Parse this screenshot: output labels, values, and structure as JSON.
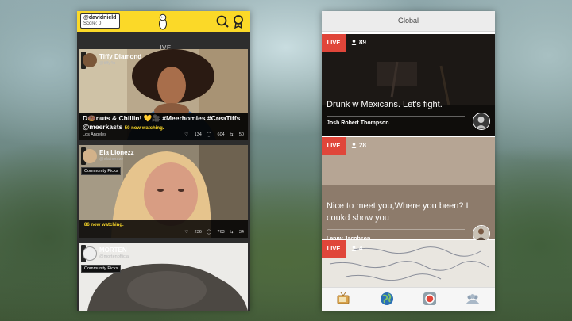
{
  "left_app": {
    "user": {
      "username": "@davidnield",
      "score": "Score: 0"
    },
    "section_label": "LIVE",
    "streams": [
      {
        "name": "Tiffy Diamond",
        "handle": "@tiffy4u",
        "title": "D🍩nuts & Chillin! 💛🎥 #Meerhomies #CreaTiffs @meerkasts",
        "watching": "59 now watching.",
        "location": "Los Angeles",
        "likes": "134",
        "comments": "604",
        "restreams": "50"
      },
      {
        "name": "Ela Lionezz",
        "handle": "@elalionezz",
        "badge": "Community Picks",
        "watching": "86 now watching.",
        "likes": "236",
        "comments": "763",
        "restreams": "34"
      },
      {
        "name": "MORTEN",
        "handle": "@mortenofficial",
        "badge": "Community Picks"
      }
    ]
  },
  "right_app": {
    "title": "Global",
    "live_label": "LIVE",
    "streams": [
      {
        "viewers": "89",
        "caption": "Drunk w Mexicans. Let's fight.",
        "user": "Josh Robert Thompson"
      },
      {
        "viewers": "28",
        "caption": "Nice to meet you,Where you been? I coukd show you",
        "user": "Lenny Jacobson"
      },
      {
        "viewers": "4"
      }
    ],
    "tabs": [
      "tv-icon",
      "globe-icon",
      "camera-icon",
      "people-icon"
    ]
  },
  "colors": {
    "brand_yellow": "#fbd928",
    "live_red": "#e0463a",
    "globe_blue": "#2a6fb5"
  }
}
